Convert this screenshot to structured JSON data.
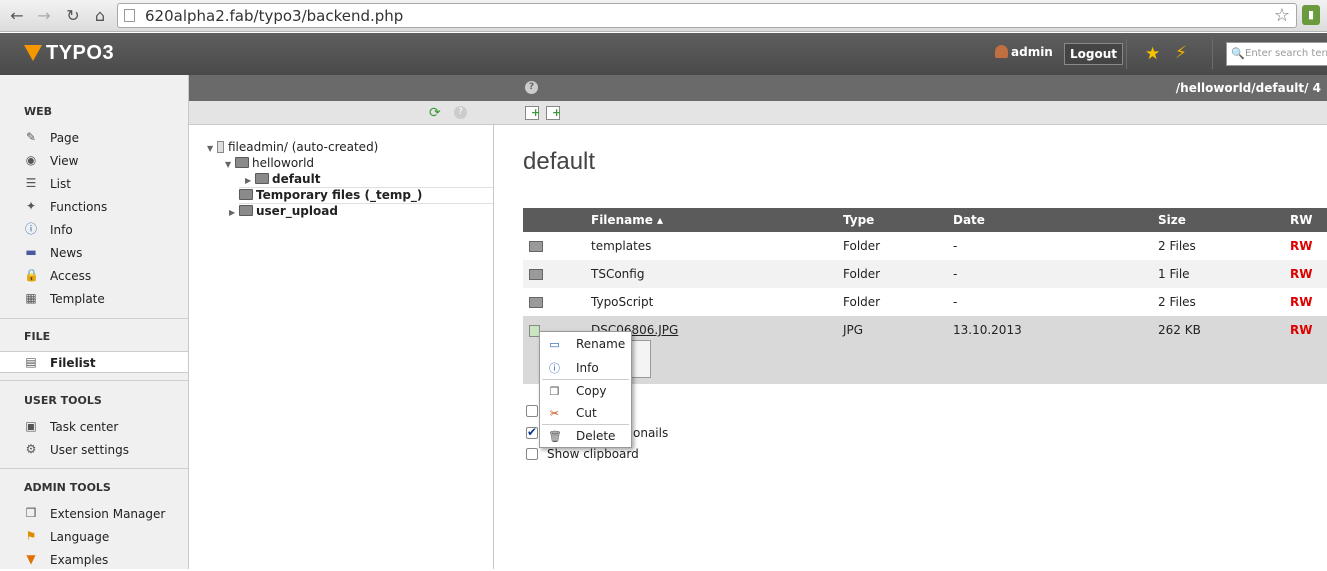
{
  "browser": {
    "url": "620alpha2.fab/typo3/backend.php"
  },
  "topbar": {
    "logo": "TYPO3",
    "user": "admin",
    "logout": "Logout",
    "search_placeholder": "Enter search term"
  },
  "modmenu": {
    "groups": [
      {
        "title": "WEB",
        "items": [
          {
            "label": "Page",
            "icon": "page-icon"
          },
          {
            "label": "View",
            "icon": "eye-icon"
          },
          {
            "label": "List",
            "icon": "list-icon"
          },
          {
            "label": "Functions",
            "icon": "wand-icon"
          },
          {
            "label": "Info",
            "icon": "info-icon"
          },
          {
            "label": "News",
            "icon": "folder-icon"
          },
          {
            "label": "Access",
            "icon": "lock-icon"
          },
          {
            "label": "Template",
            "icon": "template-icon"
          }
        ]
      },
      {
        "title": "FILE",
        "items": [
          {
            "label": "Filelist",
            "icon": "filelist-icon",
            "active": true
          }
        ]
      },
      {
        "title": "USER TOOLS",
        "items": [
          {
            "label": "Task center",
            "icon": "task-icon"
          },
          {
            "label": "User settings",
            "icon": "user-settings-icon"
          }
        ]
      },
      {
        "title": "ADMIN TOOLS",
        "items": [
          {
            "label": "Extension Manager",
            "icon": "extension-icon"
          },
          {
            "label": "Language",
            "icon": "language-icon"
          },
          {
            "label": "Examples",
            "icon": "examples-icon"
          }
        ]
      }
    ]
  },
  "path": "/helloworld/default/ 4",
  "tree": {
    "nodes": [
      {
        "label": "fileadmin/ (auto-created)"
      },
      {
        "label": "helloworld"
      },
      {
        "label": "default"
      },
      {
        "label": "Temporary files (_temp_)"
      },
      {
        "label": "user_upload"
      }
    ]
  },
  "content": {
    "title": "default",
    "headers": {
      "filename": "Filename ▴",
      "type": "Type",
      "date": "Date",
      "size": "Size",
      "rw": "RW"
    },
    "rows": [
      {
        "name": "templates",
        "type": "Folder",
        "date": "-",
        "size": "2 Files",
        "rw": "RW"
      },
      {
        "name": "TSConfig",
        "type": "Folder",
        "date": "-",
        "size": "1 File",
        "rw": "RW"
      },
      {
        "name": "TypoScript",
        "type": "Folder",
        "date": "-",
        "size": "2 Files",
        "rw": "RW"
      },
      {
        "name": "DSC06806.JPG",
        "type": "JPG",
        "date": "13.10.2013",
        "size": "262 KB",
        "rw": "RW"
      }
    ],
    "options": [
      {
        "label": "y",
        "checked": false
      },
      {
        "label": "onails",
        "checked": true
      },
      {
        "label": "Show clipboard",
        "checked": false
      }
    ]
  },
  "contextmenu": {
    "items": [
      {
        "label": "Rename",
        "icon": "rename-icon"
      },
      {
        "label": "Info",
        "icon": "info-icon"
      },
      {
        "label": "Copy",
        "icon": "copy-icon"
      },
      {
        "label": "Cut",
        "icon": "scissors-icon"
      },
      {
        "label": "Delete",
        "icon": "trash-icon"
      }
    ]
  },
  "colors": {
    "accent": "#f49700",
    "rw": "#dd0000",
    "header_bg": "#5b5b5b"
  }
}
